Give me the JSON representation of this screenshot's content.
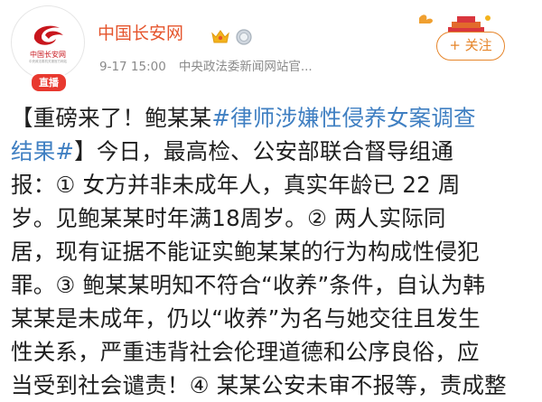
{
  "account": {
    "avatar_text": "中国长安网",
    "avatar_subtext": "中央政法委机关报官方网站",
    "live_badge": "直播",
    "name": "中国长安网",
    "timestamp": "9-17 15:00",
    "source": "中央政法委新闻网站官...",
    "badge_icons": [
      "crown-icon",
      "medal-icon"
    ]
  },
  "follow_button": {
    "label": "+ 关注"
  },
  "post": {
    "segments": [
      {
        "text": "【重磅来了！鲍某某",
        "type": "text"
      },
      {
        "text": "#律师涉嫌性侵养女案调查",
        "type": "hashtag"
      },
      {
        "text": "结果#",
        "type": "hashtag"
      },
      {
        "text": "】今日，最高检、公安部联合督导组通",
        "type": "text"
      },
      {
        "text": "报：① 女方并非未成年人，真实年龄已 22 周",
        "type": "text"
      },
      {
        "text": "岁。见鲍某某时年满18周岁。② 两人实际同",
        "type": "text"
      },
      {
        "text": "居，现有证据不能证实鲍某某的行为构成性侵犯",
        "type": "text"
      },
      {
        "text": "罪。③ 鲍某某明知不符合“收养”条件，自认为韩",
        "type": "text"
      },
      {
        "text": "某某是未成年，仍以“收养”为名与她交往且发生",
        "type": "text"
      },
      {
        "text": "性关系，严重违背社会伦理道德和公序良俗，应",
        "type": "text"
      },
      {
        "text": "当受到社会谴责！④ 某某公安未审不报等，责成整",
        "type": "text"
      }
    ]
  },
  "colors": {
    "account_name": "#e5542c",
    "hashtag": "#3f7fc2",
    "follow": "#e6852a",
    "live_badge": "#e8392f",
    "meta": "#8a8a8a"
  }
}
